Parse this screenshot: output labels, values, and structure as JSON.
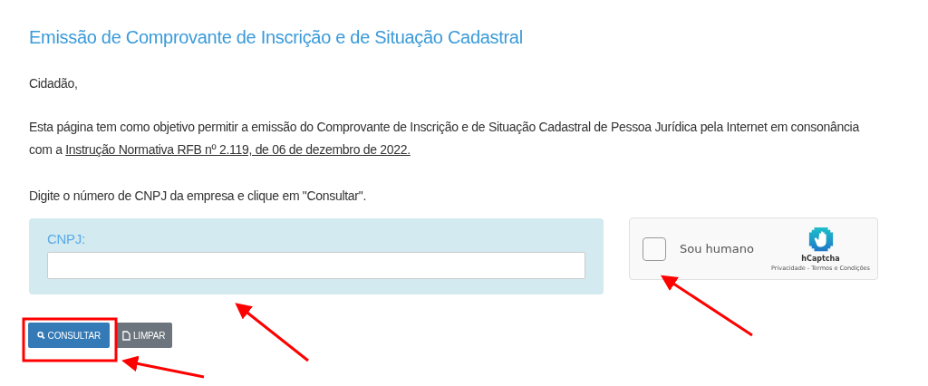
{
  "title": "Emissão de Comprovante de Inscrição e de Situação Cadastral",
  "greeting": "Cidadão,",
  "intro": {
    "text": "Esta página tem como objetivo permitir a emissão do Comprovante de Inscrição e de Situação Cadastral de Pessoa Jurídica pela Internet em consonância com a",
    "link": "Instrução Normativa RFB nº 2.119, de 06 de dezembro de 2022."
  },
  "instruction": "Digite o número de CNPJ da empresa e clique em \"Consultar\".",
  "form": {
    "label": "CNPJ:"
  },
  "captcha": {
    "label": "Sou humano",
    "checked": false,
    "brand": "hCaptcha",
    "links": "Privacidade - Termos e Condições"
  },
  "buttons": [
    {
      "kind": "primary",
      "label": "CONSULTAR"
    },
    {
      "kind": "secondary",
      "label": "LIMPAR"
    }
  ]
}
